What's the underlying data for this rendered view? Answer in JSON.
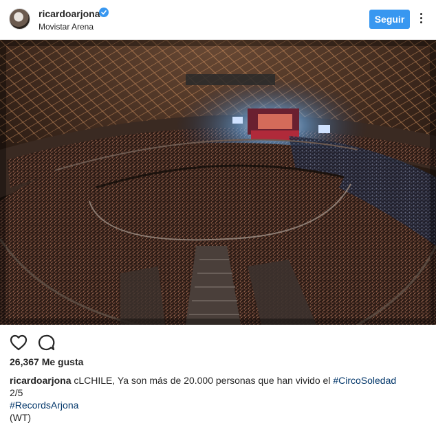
{
  "header": {
    "username": "ricardoarjona",
    "location": "Movistar Arena",
    "follow_label": "Seguir"
  },
  "icons": {
    "verified": "verified-badge-icon",
    "more": "more-options-icon",
    "like": "heart-icon",
    "comment": "comment-bubble-icon"
  },
  "colors": {
    "accent": "#3897f0",
    "hashtag": "#003569",
    "text": "#262626"
  },
  "likes": {
    "text": "26,367 Me gusta"
  },
  "caption": {
    "username": "ricardoarjona",
    "text_main": "cLCHILE, Ya son más de 20.000 personas que han vivido el",
    "hashtag_1": "#CircoSoledad",
    "line_2": "2/5",
    "hashtag_2": "#RecordsArjona",
    "line_4": "(WT)"
  }
}
